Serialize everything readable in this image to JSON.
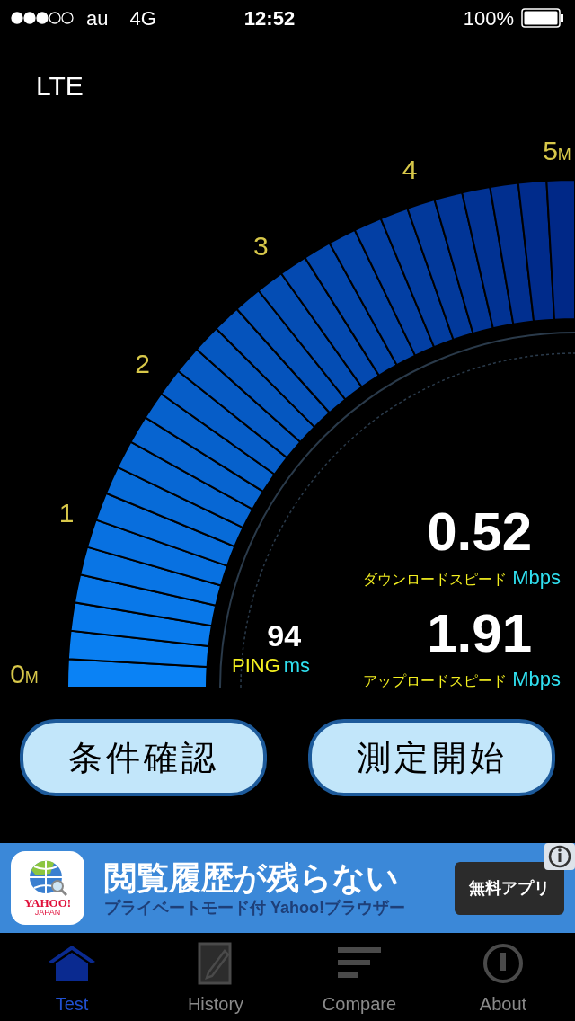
{
  "status_bar": {
    "carrier": "au",
    "network": "4G",
    "time": "12:52",
    "battery": "100%"
  },
  "network_type": "LTE",
  "gauge": {
    "ticks": [
      {
        "value": "0",
        "unit": "M"
      },
      {
        "value": "1"
      },
      {
        "value": "2"
      },
      {
        "value": "3"
      },
      {
        "value": "4"
      },
      {
        "value": "5",
        "unit": "M"
      }
    ]
  },
  "ping": {
    "value": "94",
    "label": "PING",
    "unit": "ms"
  },
  "readings": [
    {
      "value": "0.52",
      "label": "ダウンロードスピード",
      "unit": "Mbps"
    },
    {
      "value": "1.91",
      "label": "アップロードスピード",
      "unit": "Mbps"
    }
  ],
  "buttons": [
    "条件確認",
    "測定開始"
  ],
  "ad": {
    "logo_text": "YAHOO!",
    "logo_subtext": "JAPAN",
    "title": "閲覧履歴が残らない",
    "subtitle": "プライベートモード付 Yahoo!ブラウザー",
    "button": "無料アプリ"
  },
  "tabs": [
    {
      "label": "Test",
      "selected": true,
      "kind": "home"
    },
    {
      "label": "History",
      "selected": false,
      "kind": "notes"
    },
    {
      "label": "Compare",
      "selected": false,
      "kind": "bars"
    },
    {
      "label": "About",
      "selected": false,
      "kind": "info"
    }
  ]
}
